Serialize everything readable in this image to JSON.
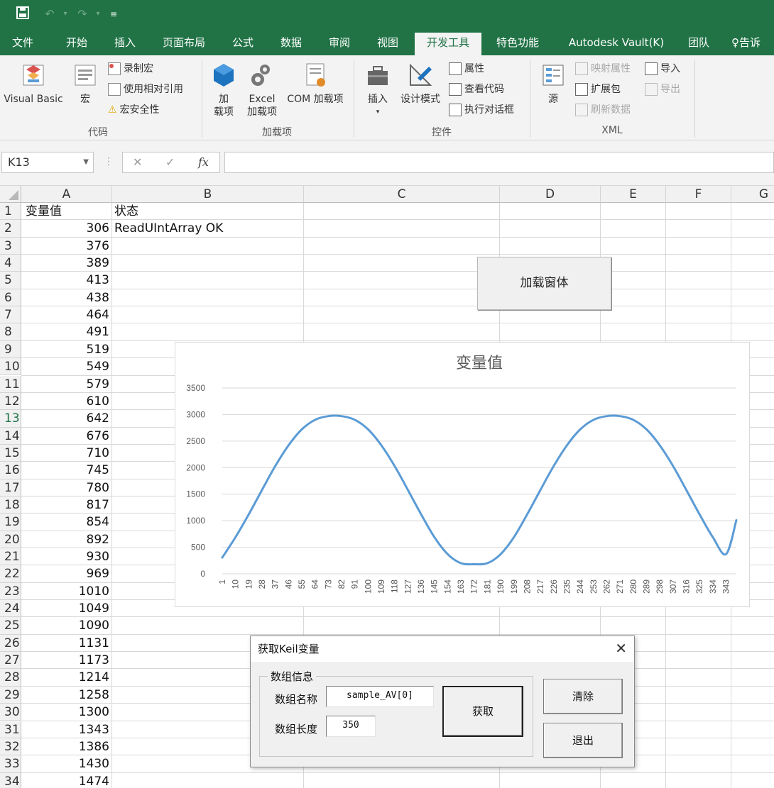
{
  "quick_access": {
    "save_icon": "save-icon",
    "undo_icon": "undo-icon",
    "redo_icon": "redo-icon",
    "customize_icon": "customize-qat-icon"
  },
  "ribbon_tabs": [
    "文件",
    "开始",
    "插入",
    "页面布局",
    "公式",
    "数据",
    "审阅",
    "视图",
    "开发工具",
    "特色功能",
    "Autodesk Vault(K)",
    "团队",
    "告诉"
  ],
  "active_tab": "开发工具",
  "ribbon": {
    "code": {
      "label": "代码",
      "visual_basic": "Visual Basic",
      "macros": "宏",
      "record_macro": "录制宏",
      "relative_refs": "使用相对引用",
      "macro_security": "宏安全性"
    },
    "addins": {
      "label": "加载项",
      "addins_line1": "加",
      "addins_line2": "载项",
      "excel_addins_line1": "Excel",
      "excel_addins_line2": "加载项",
      "com_addins": "COM 加载项"
    },
    "controls": {
      "label": "控件",
      "insert": "插入",
      "design_mode": "设计模式",
      "properties": "属性",
      "view_code": "查看代码",
      "run_dialog": "执行对话框"
    },
    "xml": {
      "label": "XML",
      "source": "源",
      "map_properties": "映射属性",
      "expansion_packs": "扩展包",
      "refresh_data": "刷新数据",
      "import": "导入",
      "export": "导出"
    }
  },
  "formula_bar": {
    "name_box": "K13",
    "cancel": "✕",
    "enter": "✓",
    "fx": "fx",
    "formula": ""
  },
  "grid": {
    "columns": [
      "A",
      "B",
      "C",
      "D",
      "E",
      "F",
      "G"
    ],
    "rows": [
      "1",
      "2",
      "3",
      "4",
      "5",
      "6",
      "7",
      "8",
      "9",
      "10",
      "11",
      "12",
      "13",
      "14",
      "15",
      "16",
      "17",
      "18",
      "19",
      "20",
      "21",
      "22",
      "23",
      "24",
      "25",
      "26",
      "27",
      "28",
      "29",
      "30",
      "31",
      "32",
      "33",
      "34"
    ],
    "selected_row": "13",
    "header_a": "变量值",
    "header_b": "状态",
    "status_b2": "ReadUIntArray OK",
    "values_a": [
      "306",
      "376",
      "389",
      "413",
      "438",
      "464",
      "491",
      "519",
      "549",
      "579",
      "610",
      "642",
      "676",
      "710",
      "745",
      "780",
      "817",
      "854",
      "892",
      "930",
      "969",
      "1010",
      "1049",
      "1090",
      "1131",
      "1173",
      "1214",
      "1258",
      "1300",
      "1343",
      "1386",
      "1430",
      "1474"
    ]
  },
  "sheet_button": {
    "label": "加载窗体"
  },
  "chart_data": {
    "type": "line",
    "title": "变量值",
    "xlabel": "",
    "ylabel": "",
    "ylim": [
      0,
      3500
    ],
    "yticks": [
      0,
      500,
      1000,
      1500,
      2000,
      2500,
      3000,
      3500
    ],
    "xticks": [
      1,
      10,
      19,
      28,
      37,
      46,
      55,
      64,
      73,
      82,
      91,
      100,
      109,
      118,
      127,
      136,
      145,
      154,
      163,
      172,
      181,
      190,
      199,
      208,
      217,
      226,
      235,
      244,
      253,
      262,
      271,
      280,
      289,
      298,
      307,
      316,
      325,
      334,
      343
    ],
    "grid": true,
    "legend": "none",
    "line_color": "#5b9bd5",
    "series": [
      {
        "x": [
          1,
          10,
          19,
          28,
          37,
          46,
          55,
          64,
          73,
          82,
          91,
          100,
          109,
          118,
          127,
          136,
          145,
          154,
          163,
          172,
          181,
          190,
          199,
          208,
          217,
          226,
          235,
          244,
          253,
          262,
          271,
          280,
          289,
          298,
          307,
          316,
          325,
          334,
          343,
          350
        ],
        "values": [
          306,
          690,
          1120,
          1580,
          2030,
          2420,
          2720,
          2900,
          2970,
          2970,
          2900,
          2720,
          2420,
          2030,
          1580,
          1120,
          690,
          370,
          200,
          180,
          200,
          370,
          690,
          1120,
          1580,
          2030,
          2420,
          2720,
          2900,
          2970,
          2970,
          2900,
          2720,
          2420,
          2030,
          1580,
          1120,
          690,
          370,
          1010
        ]
      }
    ]
  },
  "dialog": {
    "title": "获取Keil变量",
    "group_label": "数组信息",
    "name_label": "数组名称",
    "name_value": "sample_AV[0]",
    "length_label": "数组长度",
    "length_value": "350",
    "fetch_button": "获取",
    "clear_button": "清除",
    "exit_button": "退出"
  }
}
